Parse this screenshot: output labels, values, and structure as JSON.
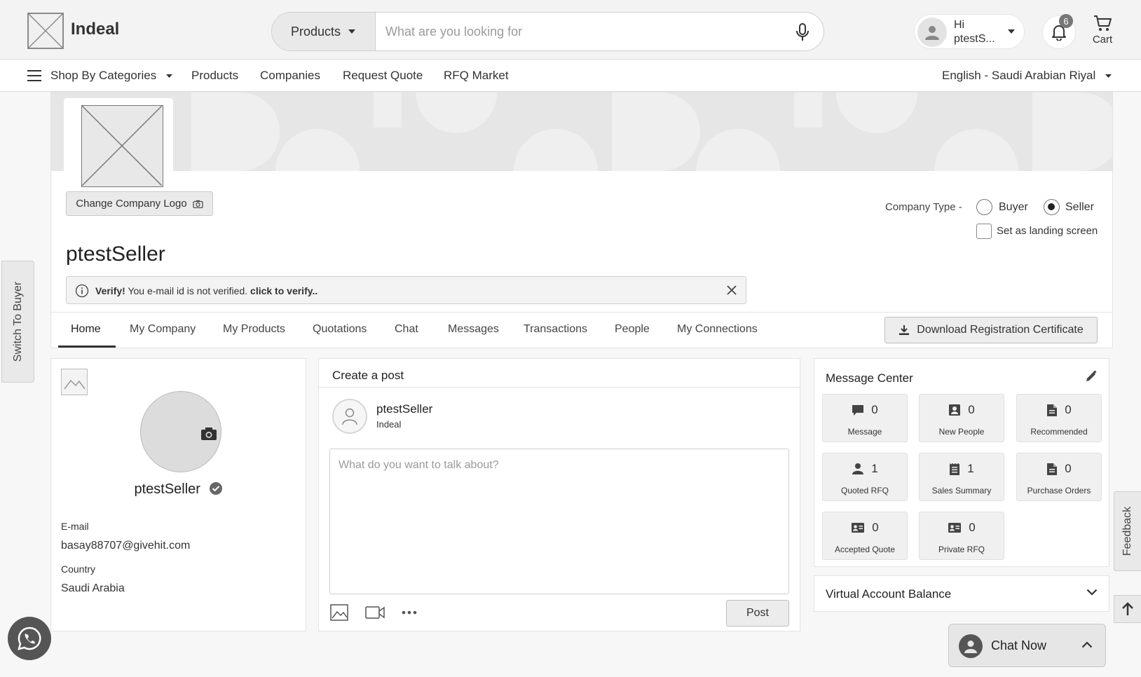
{
  "header": {
    "brand": "Indeal",
    "search": {
      "category": "Products",
      "placeholder": "What are you looking for"
    },
    "user": {
      "greeting": "Hi",
      "name": "ptestS..."
    },
    "notifications_count": "6",
    "cart_label": "Cart"
  },
  "nav": {
    "shop_by_categories": "Shop By Categories",
    "items": [
      "Products",
      "Companies",
      "Request Quote",
      "RFQ Market"
    ],
    "locale": "English - Saudi Arabian Riyal"
  },
  "side_tabs": {
    "switch": "Switch To Buyer",
    "feedback": "Feedback"
  },
  "company": {
    "change_logo": "Change Company Logo",
    "type_label": "Company Type -",
    "types": [
      "Buyer",
      "Seller"
    ],
    "selected_type": "Seller",
    "landing_label": "Set as landing screen",
    "name": "ptestSeller",
    "verify": {
      "strong": "Verify!",
      "message": "You e-mail id is not verified.",
      "link": "click to verify.."
    }
  },
  "tabs": [
    "Home",
    "My Company",
    "My Products",
    "Quotations",
    "Chat",
    "Messages",
    "Transactions",
    "People",
    "My Connections"
  ],
  "download_certificate": "Download Registration Certificate",
  "profile": {
    "name": "ptestSeller",
    "email_label": "E-mail",
    "email": "basay88707@givehit.com",
    "country_label": "Country",
    "country": "Saudi Arabia"
  },
  "post": {
    "title": "Create a post",
    "user": "ptestSeller",
    "org": "Indeal",
    "placeholder": "What do you want to talk about?",
    "button": "Post"
  },
  "message_center": {
    "title": "Message Center",
    "tiles": [
      {
        "icon": "message-icon",
        "count": "0",
        "label": "Message"
      },
      {
        "icon": "contact-icon",
        "count": "0",
        "label": "New People"
      },
      {
        "icon": "document-icon",
        "count": "0",
        "label": "Recommended"
      },
      {
        "icon": "person-icon",
        "count": "1",
        "label": "Quoted RFQ"
      },
      {
        "icon": "receipt-icon",
        "count": "1",
        "label": "Sales Summary"
      },
      {
        "icon": "document-icon",
        "count": "0",
        "label": "Purchase Orders"
      },
      {
        "icon": "id-card-icon",
        "count": "0",
        "label": "Accepted Quote"
      },
      {
        "icon": "id-card-icon",
        "count": "0",
        "label": "Private RFQ"
      }
    ]
  },
  "virtual_account": {
    "title": "Virtual Account Balance"
  },
  "chat": {
    "label": "Chat Now"
  }
}
